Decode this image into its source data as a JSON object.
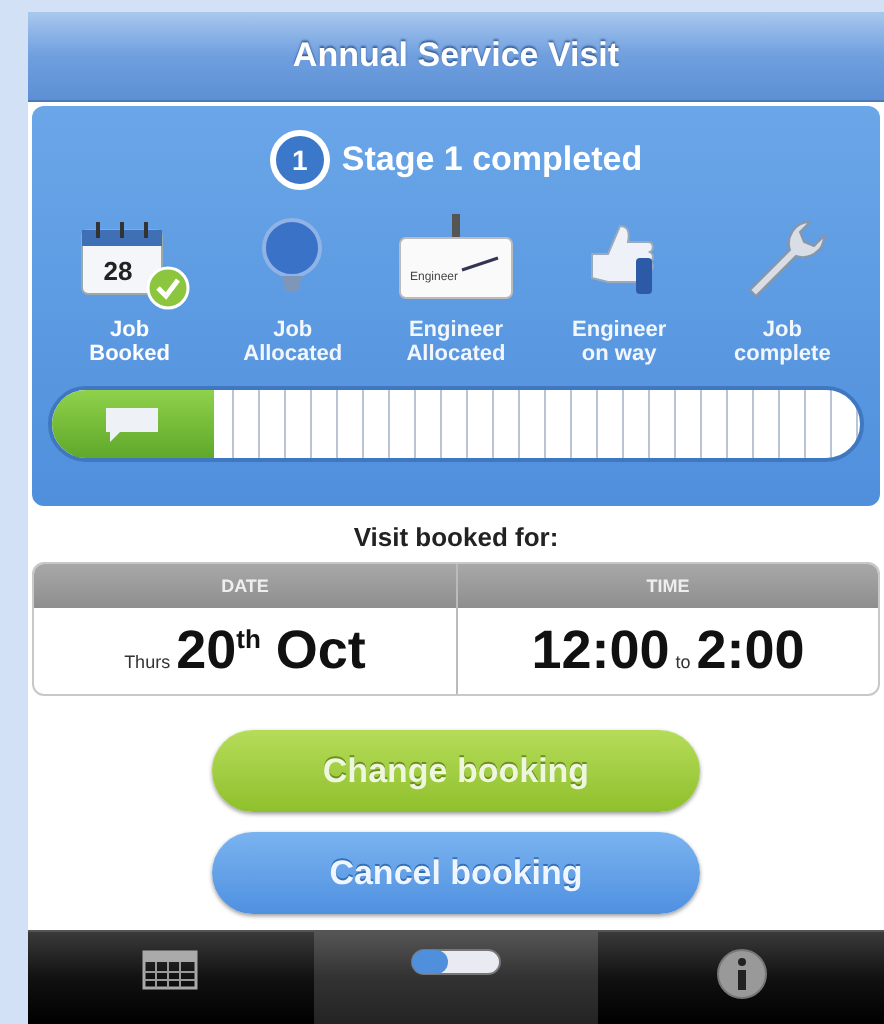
{
  "header": {
    "title": "Annual Service Visit"
  },
  "progress": {
    "stage_number": "1",
    "status": "Stage 1 completed",
    "level": 0.2,
    "stages": [
      {
        "label": "Job\nBooked",
        "kind": "calendar",
        "icon_text": "28",
        "completed": true
      },
      {
        "label": "Job\nAllocated",
        "kind": "balloon",
        "completed": false
      },
      {
        "label": "Engineer\nAllocated",
        "kind": "badge",
        "icon_text": "Engineer",
        "completed": false
      },
      {
        "label": "Engineer\non way",
        "kind": "thumb",
        "completed": false
      },
      {
        "label": "Job\ncomplete",
        "kind": "wrench",
        "completed": false
      }
    ]
  },
  "booking": {
    "heading": "Visit booked for:",
    "columns": [
      "DATE",
      "TIME"
    ],
    "day": "Thurs",
    "date": "20$^{th}$ Oct",
    "start": "12:00",
    "joiner": "to",
    "end": "2:00"
  },
  "buttons": [
    {
      "label": "Change booking",
      "kind": "primary"
    },
    {
      "label": "Cancel booking",
      "kind": "secondary"
    }
  ],
  "tab_bar": {
    "tabs": [
      {
        "kind": "calendar",
        "selected": false
      },
      {
        "kind": "progress",
        "selected": true
      },
      {
        "kind": "info",
        "selected": false
      }
    ]
  }
}
